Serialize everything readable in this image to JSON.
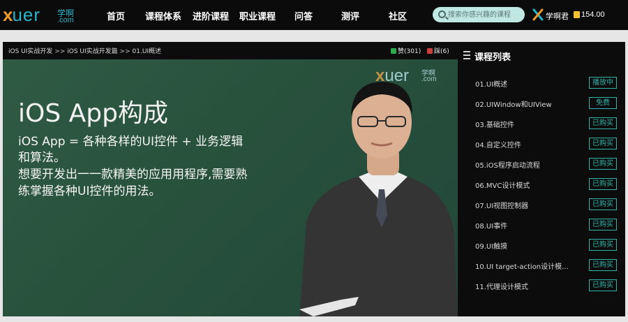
{
  "header": {
    "logo": {
      "x": "x",
      "rest": "uer",
      "cn": "学啊",
      "com": ".com"
    },
    "nav": [
      "首页",
      "课程体系",
      "进阶课程",
      "职业课程",
      "问答",
      "测评",
      "社区"
    ],
    "search": {
      "placeholder": "搜索你感兴趣的课程"
    },
    "user": {
      "name": "学啊君",
      "coins": "154.00"
    }
  },
  "breadcrumb": [
    "iOS UI实战开发",
    "iOS UI实战开发篇",
    "01.UI概述"
  ],
  "breadcrumb_sep": ">>",
  "votes": {
    "up": "赞(301)",
    "down": "踩(6)"
  },
  "video": {
    "title": "iOS App构成",
    "lines": [
      "iOS App = 各种各样的UI控件 + 业务逻辑",
      "和算法。",
      "想要开发出一一款精美的应用用程序,需要熟",
      "练掌握各种UI控件的用法。"
    ],
    "watermark": {
      "x": "x",
      "rest": "uer",
      "cn": "学啊",
      "com": ".com"
    }
  },
  "course_list": {
    "title": "课程列表",
    "items": [
      {
        "title": "01.UI概述",
        "status": "播放中"
      },
      {
        "title": "02.UIWindow和UIView",
        "status": "免费"
      },
      {
        "title": "03.基础控件",
        "status": "已购买"
      },
      {
        "title": "04.自定义控件",
        "status": "已购买"
      },
      {
        "title": "05.iOS程序启动流程",
        "status": "已购买"
      },
      {
        "title": "06.MVC设计模式",
        "status": "已购买"
      },
      {
        "title": "07.UI视图控制器",
        "status": "已购买"
      },
      {
        "title": "08.UI事件",
        "status": "已购买"
      },
      {
        "title": "09.UI触摸",
        "status": "已购买"
      },
      {
        "title": "10.UI target-action设计模...",
        "status": "已购买"
      },
      {
        "title": "11.代理设计模式",
        "status": "已购买"
      }
    ]
  },
  "colors": {
    "accent": "#35b3a8",
    "topbar": "#0b0b0b",
    "board": "#2f5a44"
  }
}
